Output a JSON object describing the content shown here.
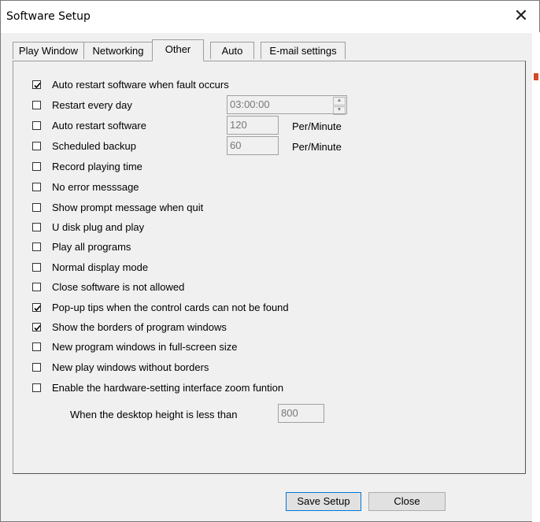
{
  "window": {
    "title": "Software Setup",
    "close_glyph": "✕"
  },
  "tabs": [
    {
      "label": "Play Window",
      "active": false
    },
    {
      "label": "Networking",
      "active": false
    },
    {
      "label": "Other",
      "active": true
    },
    {
      "label": "Auto",
      "active": false
    },
    {
      "label": "E-mail settings",
      "active": false
    }
  ],
  "options": [
    {
      "label": "Auto restart software when fault occurs",
      "checked": true
    },
    {
      "label": "Restart every day",
      "checked": false
    },
    {
      "label": "Auto restart software",
      "checked": false
    },
    {
      "label": "Scheduled backup",
      "checked": false
    },
    {
      "label": "Record playing time",
      "checked": false
    },
    {
      "label": "No error messsage",
      "checked": false
    },
    {
      "label": "Show prompt message when quit",
      "checked": false
    },
    {
      "label": "U disk plug and play",
      "checked": false
    },
    {
      "label": "Play all programs",
      "checked": false
    },
    {
      "label": "Normal display mode",
      "checked": false
    },
    {
      "label": "Close software is not allowed",
      "checked": false
    },
    {
      "label": "Pop-up tips when the control cards can not be found",
      "checked": true
    },
    {
      "label": "Show the borders of program windows",
      "checked": true
    },
    {
      "label": "New program windows in full-screen size",
      "checked": false
    },
    {
      "label": "New play windows without borders",
      "checked": false
    },
    {
      "label": "Enable the hardware-setting interface zoom funtion",
      "checked": false
    }
  ],
  "fields": {
    "restart_time": "03:00:00",
    "auto_restart_interval": "120",
    "backup_interval": "60",
    "unit_label": "Per/Minute",
    "desktop_height_label": "When the desktop height is less than",
    "desktop_height": "800"
  },
  "buttons": {
    "save": "Save Setup",
    "close": "Close"
  },
  "icons": {
    "check": "check-icon",
    "close": "close-icon"
  }
}
